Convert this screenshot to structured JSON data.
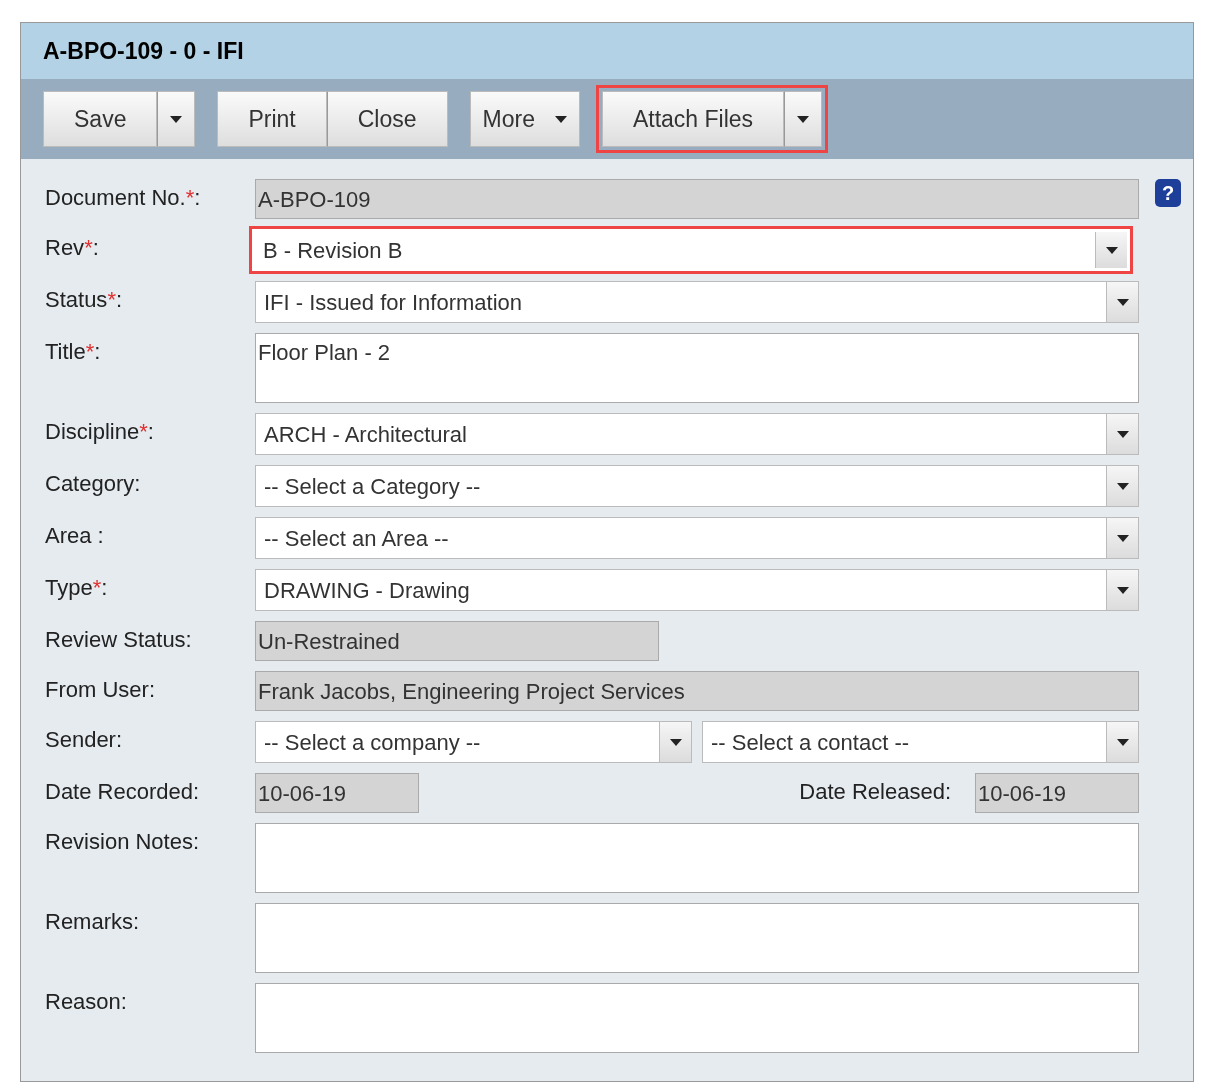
{
  "window": {
    "title": "A-BPO-109 - 0 - IFI"
  },
  "toolbar": [
    {
      "buttons": [
        {
          "label": "Save",
          "kind": "text"
        },
        {
          "kind": "caret"
        }
      ],
      "highlighted": false
    },
    {
      "buttons": [
        {
          "label": "Print",
          "kind": "text"
        },
        {
          "label": "Close",
          "kind": "text"
        }
      ],
      "highlighted": false
    },
    {
      "buttons": [
        {
          "label": "More",
          "kind": "menu"
        }
      ],
      "highlighted": false
    },
    {
      "buttons": [
        {
          "label": "Attach Files",
          "kind": "text"
        },
        {
          "kind": "caret"
        }
      ],
      "highlighted": true
    }
  ],
  "form": {
    "rows": [
      {
        "kind": "readonly",
        "label": "Document No.",
        "required_mark": "*",
        "colon": ":",
        "value": "A-BPO-109",
        "help": "?"
      },
      {
        "kind": "select",
        "label": "Rev",
        "required_mark": "*",
        "colon": ":",
        "value": "B - Revision B",
        "highlighted": true
      },
      {
        "kind": "select",
        "label": "Status",
        "required_mark": "*",
        "colon": ":",
        "value": "IFI - Issued for Information",
        "highlighted": false
      },
      {
        "kind": "textarea",
        "label": "Title",
        "required_mark": "*",
        "colon": ":",
        "value": "Floor Plan - 2"
      },
      {
        "kind": "select",
        "label": "Discipline",
        "required_mark": "*",
        "colon": ":",
        "value": "ARCH - Architectural",
        "highlighted": false
      },
      {
        "kind": "select",
        "label": "Category:",
        "value": "-- Select a Category --",
        "highlighted": false
      },
      {
        "kind": "select",
        "label": "Area :",
        "value": "-- Select an Area --",
        "highlighted": false
      },
      {
        "kind": "select",
        "label": "Type",
        "required_mark": "*",
        "colon": ":",
        "value": "DRAWING - Drawing",
        "highlighted": false
      },
      {
        "kind": "readonly_short",
        "label": "Review Status:",
        "value": "Un-Restrained"
      },
      {
        "kind": "readonly",
        "label": "From User:",
        "value": "Frank Jacobs, Engineering Project Services"
      },
      {
        "kind": "pair_select",
        "label": "Sender:",
        "values": [
          "-- Select a company --",
          "-- Select a contact --"
        ]
      },
      {
        "kind": "dates",
        "label": "Date Recorded:",
        "value": "10-06-19",
        "label_2": "Date Released:",
        "value_2": "10-06-19"
      },
      {
        "kind": "textarea",
        "label": "Revision Notes:"
      },
      {
        "kind": "textarea",
        "label": "Remarks:"
      },
      {
        "kind": "textarea",
        "label": "Reason:"
      }
    ]
  }
}
